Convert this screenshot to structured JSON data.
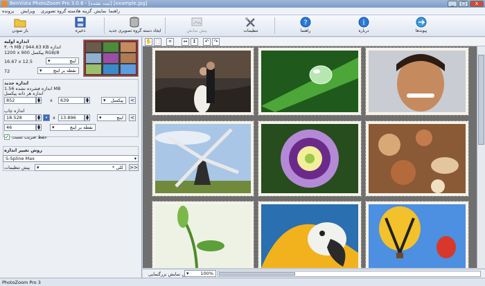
{
  "window": {
    "title": "BenVista PhotoZoom Pro 3.0.6 - [ثبت نشده] [example.jpg]",
    "minimize": "_",
    "maximize": "□",
    "close": "x"
  },
  "menu": [
    "راهنما",
    "نمایش",
    "گزینه ها",
    "دسته گروه تصویری",
    "ویرایش",
    "پرونده"
  ],
  "toolbar": {
    "open": "باز نمودن",
    "save": "ذخیره",
    "batch": "ایجاد دسته گروه تصویری جدید",
    "show_original": "پیش نمایش",
    "settings": "تنظیمات",
    "help": "راهنما",
    "about": "درباره",
    "links": "پیوندها"
  },
  "left": {
    "original_size_heading": "اندازه اولیه",
    "file_info": "۳.۰۹ MB / 944.63 KB اندازه",
    "pixel_info": "1200 x 900 پیکسل RGB/8",
    "size_inches": "16.67 x 12.5",
    "unit_inch": "اینچ",
    "resolution": "72",
    "unit_ppi": "نقطه بر اینچ",
    "new_size_heading": "اندازه جدید",
    "new_file_info": "اندازه فشرده نشده 1.56 MB",
    "pixel_size_label": "اندازه هر ذانه پیکسل",
    "width_px": "852",
    "height_px": "639",
    "unit_pixel": "پیکسل",
    "print_size_label": "اندازه چاپ",
    "width_in": "18.528",
    "height_in": "13.896",
    "unit_inch2": "اینچ",
    "print_res": "46",
    "unit_ppi2": "نقطه بر اینچ",
    "keep_ratio_label": "حفظ ضریب نسبت",
    "keep_ratio_checked": true,
    "method_heading": "روش تغییر اندازه",
    "method": "S-Spline Max",
    "preset_label": "پیش تنظیمات",
    "preset_value": "* کلی",
    "arrow_left": "<",
    "double_arrow": ">>"
  },
  "viewtools": {
    "hand": "✋",
    "select": "⬚",
    "crop": "⌗",
    "fit_width": "↔",
    "fit_height": "↕",
    "undo": "↶",
    "redo": "↷"
  },
  "bottom": {
    "zoom_label": "پیش نمایش بزرگنمایی",
    "zoom_value": "100%"
  },
  "status": "PhotoZoom Pro 3",
  "colors": {
    "accent": "#2b6cc4",
    "folder": "#f0c33c",
    "help_blue": "#2a7ad6"
  }
}
